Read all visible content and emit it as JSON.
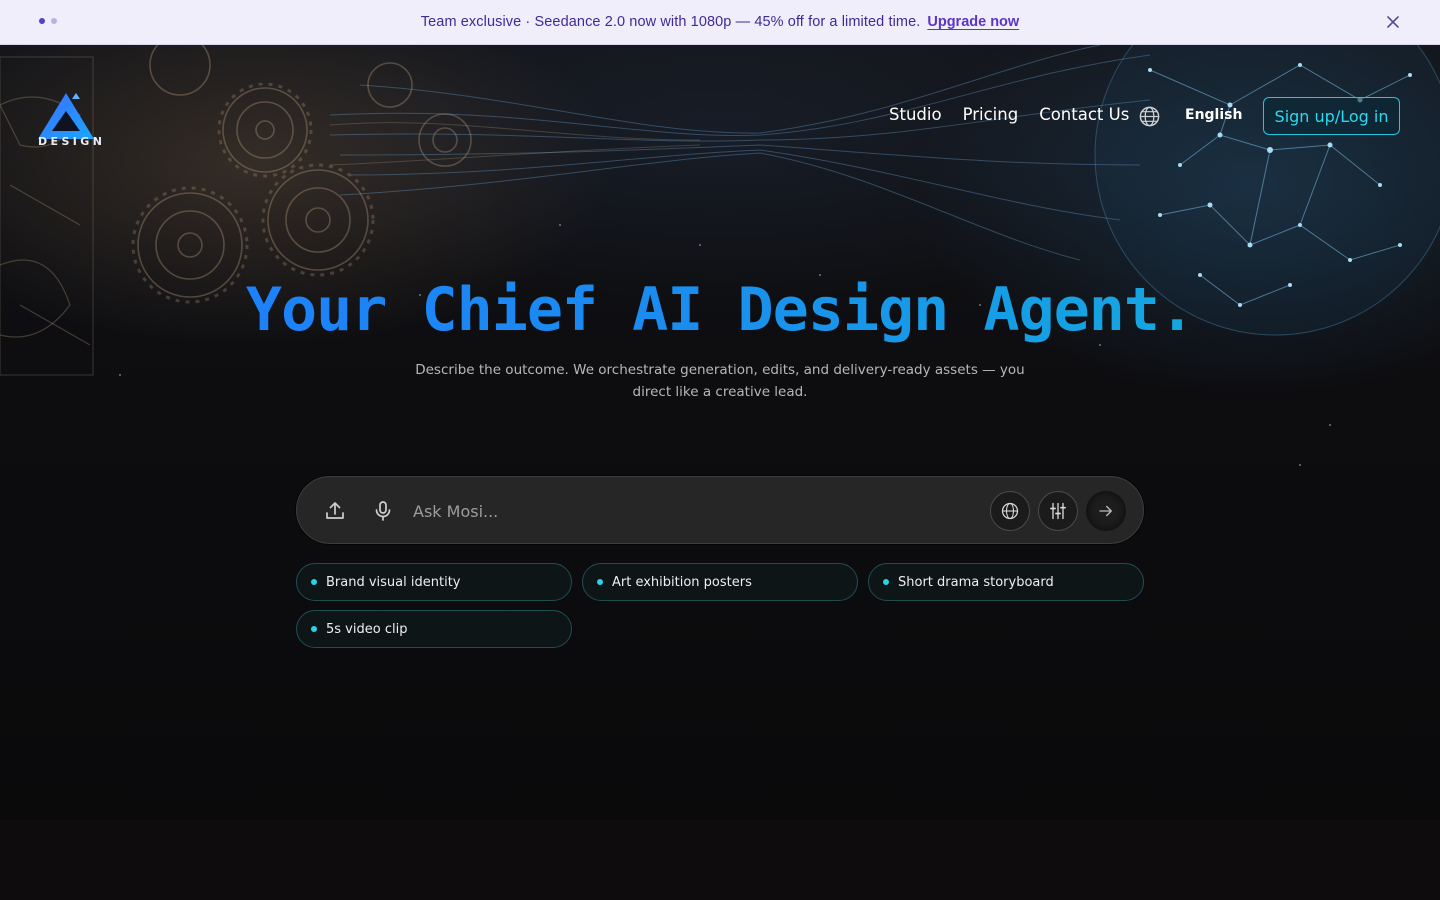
{
  "announcement": {
    "message": "Team exclusive · Seedance 2.0 now with 1080p — 45% off for a limited time.",
    "cta": "Upgrade now",
    "dots": [
      true,
      false
    ]
  },
  "brand": {
    "logo_text": "DESIGN"
  },
  "nav": {
    "links": [
      "Studio",
      "Pricing",
      "Contact Us"
    ],
    "language": "English",
    "signup": "Sign up/Log in"
  },
  "hero": {
    "headline": "Your Chief AI Design Agent.",
    "subtitle": "Describe the outcome. We orchestrate generation, edits, and delivery-ready assets — you direct like a creative lead."
  },
  "ask": {
    "placeholder": "Ask Mosi..."
  },
  "suggestions": [
    "Brand visual identity",
    "Art exhibition posters",
    "Short drama storyboard",
    "5s video clip"
  ],
  "colors": {
    "accent": "#22c6e0",
    "headline_start": "#1f7bff",
    "headline_end": "#12b3d8",
    "announce_bg": "#f1eefb",
    "announce_text": "#3f2a96"
  }
}
